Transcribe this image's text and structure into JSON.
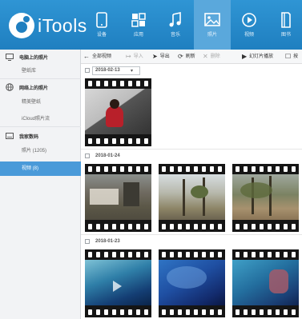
{
  "app": {
    "name": "iTools"
  },
  "nav": [
    {
      "label": "设备",
      "icon": "device-icon",
      "active": false
    },
    {
      "label": "应用",
      "icon": "apps-icon",
      "active": false
    },
    {
      "label": "音乐",
      "icon": "music-icon",
      "active": false
    },
    {
      "label": "照片",
      "icon": "photo-icon",
      "active": true
    },
    {
      "label": "视频",
      "icon": "video-icon",
      "active": false
    },
    {
      "label": "图书",
      "icon": "book-icon",
      "active": false
    }
  ],
  "sidebar": {
    "sections": [
      {
        "title": "电脑上的照片",
        "icon": "monitor-icon",
        "items": [
          {
            "label": "壁纸库",
            "active": false
          }
        ]
      },
      {
        "title": "网络上的照片",
        "icon": "globe-icon",
        "items": [
          {
            "label": "精美壁纸",
            "active": false
          },
          {
            "label": "iCloud照片流",
            "active": false
          }
        ]
      },
      {
        "title": "我家数码",
        "icon": "phone-icon",
        "items": [
          {
            "label": "照片 (1205)",
            "active": false
          },
          {
            "label": "视频 (8)",
            "active": true
          }
        ]
      }
    ]
  },
  "toolbar": {
    "select_all": "全部视频",
    "import": "导入",
    "export": "导出",
    "refresh": "刷新",
    "delete": "删除",
    "slideshow": "幻灯片播放",
    "more": "按"
  },
  "groups": [
    {
      "date": "2018-02-13",
      "has_dropdown": true,
      "count": 1
    },
    {
      "date": "2018-01-24",
      "has_dropdown": false,
      "count": 3
    },
    {
      "date": "2018-01-23",
      "has_dropdown": false,
      "count": 3
    }
  ],
  "colors": {
    "accent": "#1f7fc0",
    "selected": "#4a9ad9"
  }
}
